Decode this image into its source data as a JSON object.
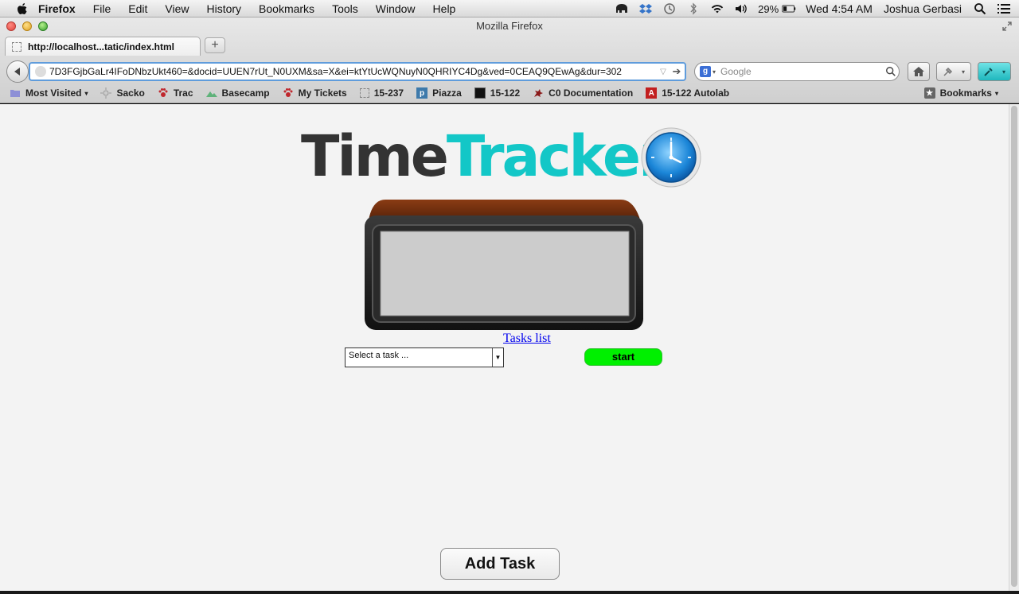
{
  "menubar": {
    "app": "Firefox",
    "items": [
      "File",
      "Edit",
      "View",
      "History",
      "Bookmarks",
      "Tools",
      "Window",
      "Help"
    ],
    "battery": "29%",
    "clock": "Wed 4:54 AM",
    "user": "Joshua Gerbasi"
  },
  "window": {
    "title": "Mozilla Firefox"
  },
  "tab": {
    "title": "http://localhost...tatic/index.html",
    "new_tab": "+"
  },
  "navbar": {
    "url": "7D3FGjbGaLr4IFoDNbzUkt460=&docid=UUEN7rUt_N0UXM&sa=X&ei=ktYtUcWQNuyN0QHRIYC4Dg&ved=0CEAQ9QEwAg&dur=302",
    "search_placeholder": "Google"
  },
  "bookmarks": {
    "items": [
      {
        "label": "Most Visited",
        "icon": "folder-icon"
      },
      {
        "label": "Sacko",
        "icon": "sun-icon"
      },
      {
        "label": "Trac",
        "icon": "paw-icon"
      },
      {
        "label": "Basecamp",
        "icon": "mountain-icon"
      },
      {
        "label": "My Tickets",
        "icon": "paw-icon"
      },
      {
        "label": "15-237",
        "icon": "blank-page-icon"
      },
      {
        "label": "Piazza",
        "icon": "piazza-icon"
      },
      {
        "label": "15-122",
        "icon": "black-square-icon"
      },
      {
        "label": "C0 Documentation",
        "icon": "dragon-icon"
      },
      {
        "label": "15-122 Autolab",
        "icon": "autolab-icon"
      }
    ],
    "right_label": "Bookmarks"
  },
  "page": {
    "logo_part1": "Time",
    "logo_part2": "Tracker",
    "tasks_link": "Tasks list",
    "select_placeholder": "Select a task ...",
    "start_button": "start",
    "add_task_button": "Add Task"
  },
  "colors": {
    "logo_dark": "#333333",
    "logo_teal": "#13c7c7",
    "start_green": "#00f000",
    "link_blue": "#0000ee"
  }
}
